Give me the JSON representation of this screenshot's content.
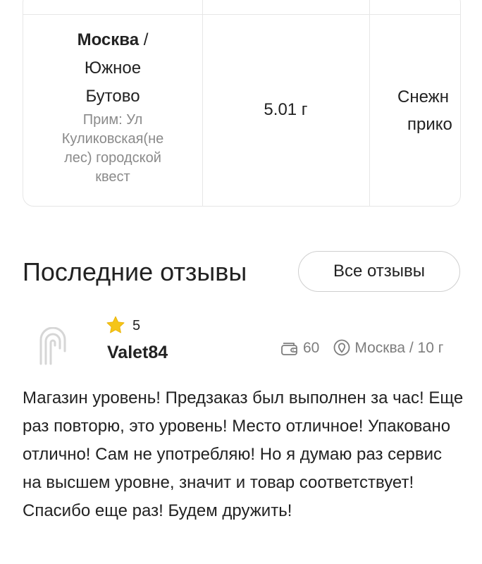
{
  "table": {
    "location_city": "Москва",
    "location_sep": " /",
    "location_district_line1": "Южное",
    "location_district_line2": "Бутово",
    "location_note_lines": [
      "Прим: Ул",
      "Куликовская(не",
      "лес) городской",
      "квест"
    ],
    "weight": "5.01 г",
    "product_line1": "Снежн",
    "product_line2": "прико"
  },
  "reviews": {
    "title": "Последние отзывы",
    "all_button": "Все отзывы",
    "items": [
      {
        "rating": "5",
        "username": "Valet84",
        "purchases": "60",
        "location": "Москва / 10 г",
        "text": "Магазин уровень! Предзаказ был выполнен за час! Еще раз повторю, это уровень! Место отличное! Упаковано отлично! Сам не употребляю! Но я думаю раз сервис на высшем уровне, значит и товар соответствует! Спасибо еще раз! Будем дружить!"
      }
    ]
  },
  "icons": {
    "star": "star-icon",
    "wallet": "wallet-icon",
    "location": "map-pin-icon",
    "avatar": "brand-logo-icon"
  },
  "colors": {
    "star": "#f5c518",
    "border": "#e6e6e6",
    "muted_text": "#7d7d7d"
  }
}
